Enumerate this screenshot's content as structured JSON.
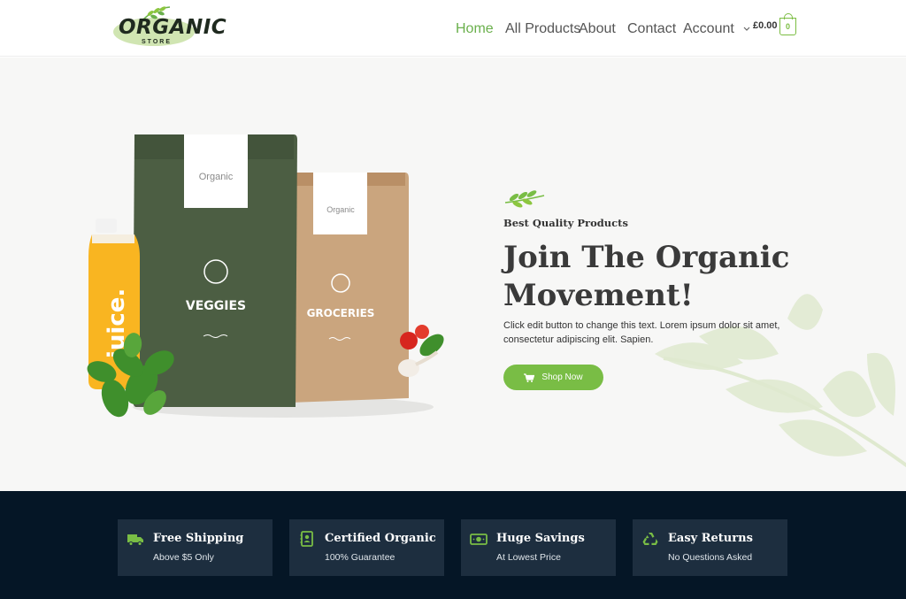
{
  "header": {
    "logo": {
      "title": "ORGANIC",
      "subtitle": "STORE"
    },
    "nav": [
      {
        "label": "Home",
        "active": true
      },
      {
        "label": "All Products",
        "active": false
      },
      {
        "label": "About",
        "active": false
      },
      {
        "label": "Contact",
        "active": false
      },
      {
        "label": "Account",
        "active": false,
        "has_dropdown": true
      }
    ],
    "cart": {
      "total": "£0.00",
      "count": "0"
    }
  },
  "hero": {
    "tagline": "Best Quality Products",
    "headline": "Join The Organic Movement!",
    "description": "Click edit button to change this text. Lorem ipsum dolor sit amet, consectetur adipiscing elit. Sapien.",
    "button_label": "Shop Now",
    "product_labels": {
      "green_bag_brand": "Organic",
      "green_bag_name": "VEGGIES",
      "kraft_bag_brand": "Organic",
      "kraft_bag_name": "GROCERIES",
      "bottle_label": "juice."
    }
  },
  "features": [
    {
      "icon": "truck-icon",
      "title": "Free Shipping",
      "subtitle": "Above $5 Only"
    },
    {
      "icon": "certificate-icon",
      "title": "Certified Organic",
      "subtitle": "100% Guarantee"
    },
    {
      "icon": "money-icon",
      "title": "Huge Savings",
      "subtitle": "At Lowest Price"
    },
    {
      "icon": "recycle-icon",
      "title": "Easy Returns",
      "subtitle": "No Questions Asked"
    }
  ],
  "colors": {
    "accent": "#79bd45",
    "nav_active": "#6ab04c",
    "feature_bar": "#051626",
    "feature_card": "#1d2e3f",
    "hero_bg": "#f7f7f6"
  }
}
